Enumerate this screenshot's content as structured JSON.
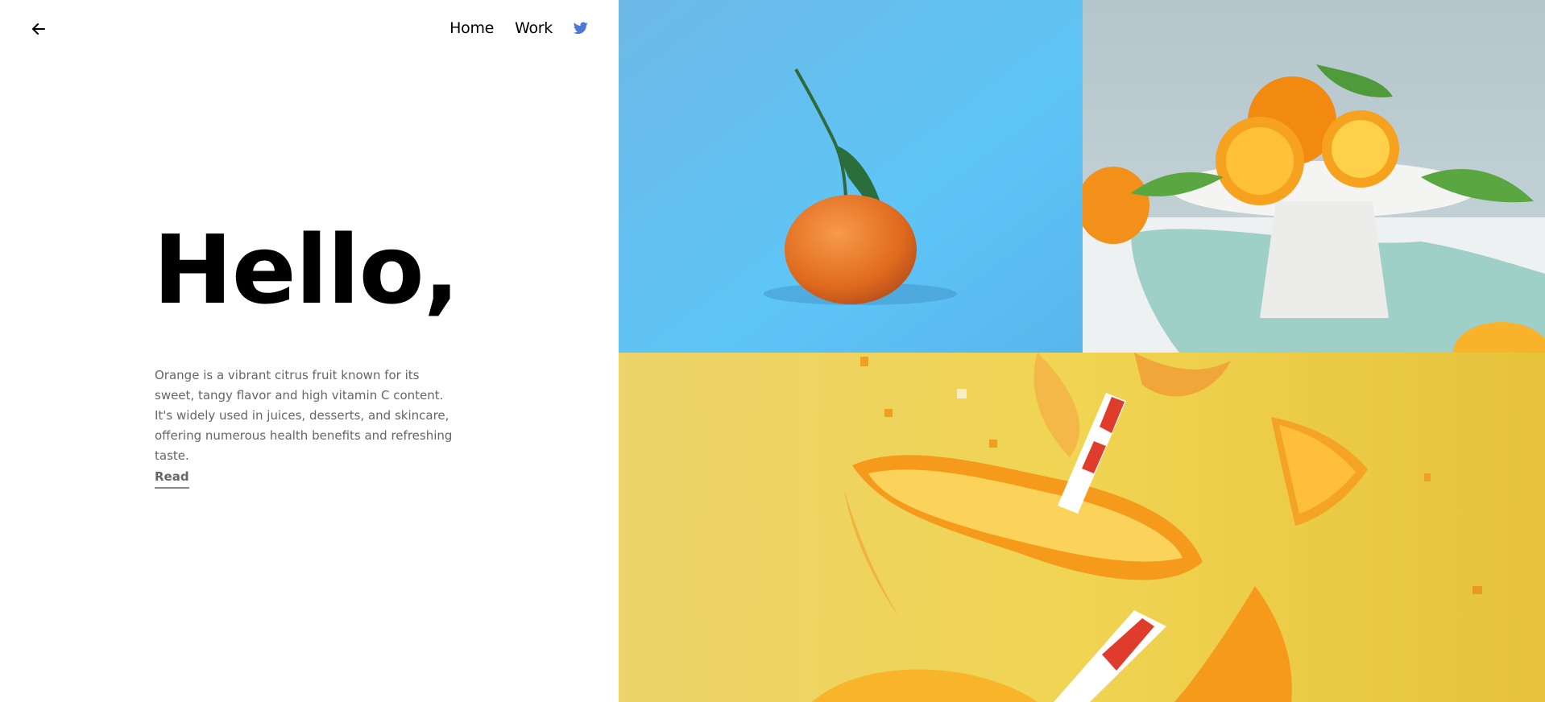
{
  "nav": {
    "back_icon": "arrow-left-icon",
    "items": [
      {
        "label": "Home"
      },
      {
        "label": "Work"
      }
    ],
    "social_icon": "twitter-icon",
    "social_color": "#4a78d6"
  },
  "hero": {
    "title": "Hello,",
    "description": "Orange is a vibrant citrus fruit known for its sweet, tangy flavor and high vitamin C content. It's widely used in juices, desserts, and skincare, offering numerous health benefits and refreshing taste.",
    "cta_label": "Read"
  },
  "gallery": {
    "tiles": [
      {
        "subject": "single tangerine with leafy stem on blue background",
        "color": "#5bbcf0"
      },
      {
        "subject": "halved oranges with leaves on white cake stand",
        "color": "#b8c8cf"
      },
      {
        "subject": "orange peels, slices and striped straw on yellow background",
        "color": "#e8c84a"
      }
    ]
  }
}
